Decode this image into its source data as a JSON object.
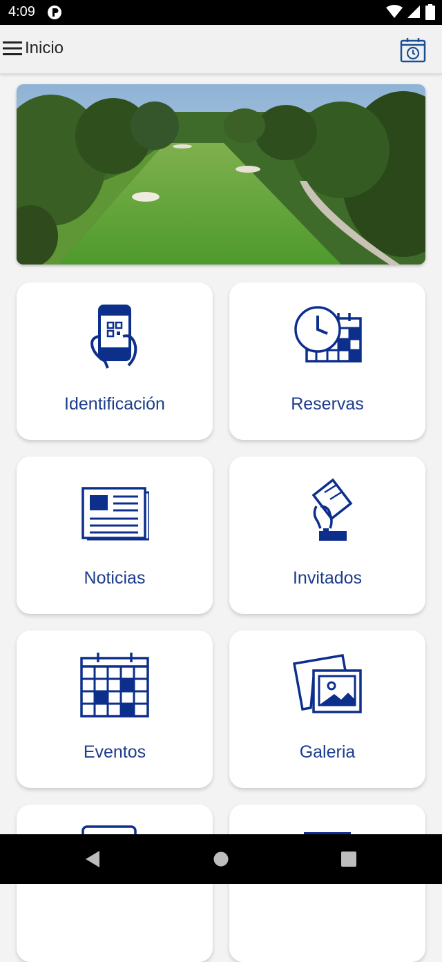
{
  "status_bar": {
    "time": "4:09",
    "icons": [
      "app-notification-icon",
      "wifi-icon",
      "signal-icon",
      "battery-icon"
    ]
  },
  "app_bar": {
    "title": "Inicio",
    "left_icon": "menu-icon",
    "right_icon": "calendar-clock-icon"
  },
  "hero": {
    "image": "golf course fairway with trees"
  },
  "tiles": [
    {
      "label": "Identificación",
      "icon": "phone-qr-icon"
    },
    {
      "label": "Reservas",
      "icon": "clock-calendar-icon"
    },
    {
      "label": "Noticias",
      "icon": "newspaper-icon"
    },
    {
      "label": "Invitados",
      "icon": "hand-card-icon"
    },
    {
      "label": "Eventos",
      "icon": "calendar-icon"
    },
    {
      "label": "Galeria",
      "icon": "gallery-icon"
    }
  ],
  "nav_bar": {
    "icons": [
      "back-icon",
      "home-icon",
      "recents-icon"
    ]
  },
  "colors": {
    "accent": "#0d2f8c",
    "label": "#1c3c8c",
    "background": "#f3f3f3"
  }
}
